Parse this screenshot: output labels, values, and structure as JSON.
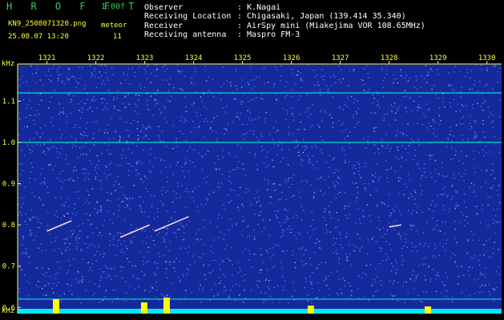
{
  "header": {
    "brand": "H R O F F T",
    "version": "1.00f",
    "filename": "KN9_2508071320.png",
    "mode": "meteor",
    "timestamp": "25.08.07 13:20",
    "count": "11",
    "meta": [
      {
        "label": "Observer",
        "value": ": K.Nagai"
      },
      {
        "label": "Receiving Location",
        "value": ": Chigasaki, Japan (139.414 35.340)"
      },
      {
        "label": "Receiver",
        "value": ": AirSpy mini (Miakejima VOR 108.65MHz)"
      },
      {
        "label": "Receiving antenna",
        "value": ": Maspro FM-3"
      }
    ]
  },
  "spectrogram": {
    "y_unit_top": "kHz",
    "y_unit_bottom": "kHz",
    "x_ticks": [
      "1321",
      "1322",
      "1323",
      "1324",
      "1325",
      "1326",
      "1327",
      "1328",
      "1329",
      "1330"
    ],
    "y_ticks": [
      "1.1",
      "1.0",
      "0.9",
      "0.8",
      "0.7",
      "0.6"
    ],
    "y_tick_values": [
      1.1,
      1.0,
      0.9,
      0.8,
      0.7,
      0.6
    ],
    "y_range": [
      0.585,
      1.19
    ],
    "x_range": [
      1320.4,
      1330.3
    ],
    "colors": {
      "background": "#142a9c",
      "noise": "#4f7dff",
      "carrier": "#00e0c8",
      "axis": "#ffff3a",
      "power": "#00e8ff",
      "power_spike": "#ffff00"
    },
    "carriers_khz": [
      1.12,
      1.0,
      0.62
    ],
    "meteor_traces": [
      {
        "x": [
          1321.0,
          1321.5
        ],
        "y": [
          0.785,
          0.81
        ]
      },
      {
        "x": [
          1322.5,
          1323.1
        ],
        "y": [
          0.77,
          0.8
        ]
      },
      {
        "x": [
          1323.2,
          1323.9
        ],
        "y": [
          0.785,
          0.82
        ]
      },
      {
        "x": [
          1328.0,
          1328.25
        ],
        "y": [
          0.795,
          0.8
        ]
      }
    ]
  }
}
